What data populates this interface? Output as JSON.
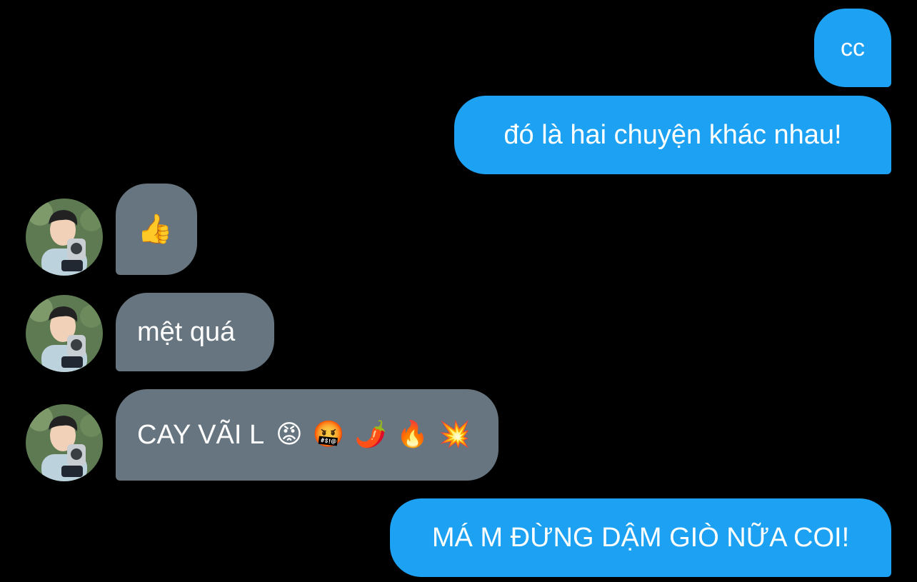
{
  "conversation": {
    "messages": [
      {
        "direction": "sent",
        "text": "cc"
      },
      {
        "direction": "sent",
        "text": "đó là hai chuyện khác nhau!"
      },
      {
        "direction": "received",
        "text": "👍"
      },
      {
        "direction": "received",
        "text": "mệt quá"
      },
      {
        "direction": "received",
        "text": "CAY VÃI L",
        "emojis": [
          "😡",
          "🤬",
          "🌶️",
          "🔥",
          "💥"
        ]
      },
      {
        "direction": "sent",
        "text": "MÁ M ĐỪNG DẬM GIÒ NỮA COI!"
      }
    ]
  },
  "colors": {
    "background": "#000000",
    "sent_bubble": "#1da1f2",
    "received_bubble": "#66757f",
    "text": "#ffffff"
  },
  "icons": {
    "avatar": "user-avatar-photo"
  }
}
